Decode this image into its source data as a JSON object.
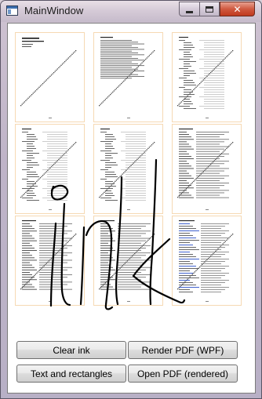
{
  "window": {
    "title": "MainWindow",
    "icon": "application-window-icon"
  },
  "caption_buttons": {
    "minimize": "minimize-icon",
    "maximize": "maximize-icon",
    "close": "close-icon",
    "close_glyph": "✕"
  },
  "buttons": {
    "clear_ink": "Clear ink",
    "render_pdf_wpf": "Render PDF (WPF)",
    "text_and_rectangles": "Text and rectangles",
    "open_pdf_rendered": "Open PDF (rendered)"
  },
  "pages": [
    {
      "index": 1,
      "style": "title-page"
    },
    {
      "index": 2,
      "style": "text-page"
    },
    {
      "index": 3,
      "style": "toc-page"
    },
    {
      "index": 4,
      "style": "toc-page"
    },
    {
      "index": 5,
      "style": "toc-page"
    },
    {
      "index": 6,
      "style": "list-page"
    },
    {
      "index": 7,
      "style": "list-page"
    },
    {
      "index": 8,
      "style": "list-page"
    },
    {
      "index": 9,
      "style": "colored-list-page"
    }
  ],
  "colors": {
    "ink": "#000000",
    "page_border": "#f6d9b3",
    "blue_text": "#2b50c8"
  }
}
